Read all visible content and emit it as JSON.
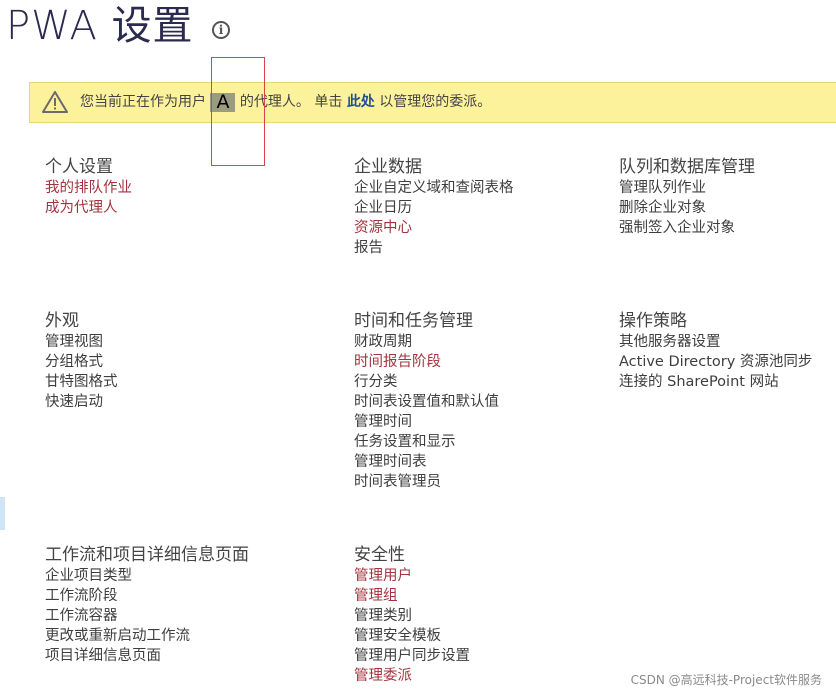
{
  "page": {
    "title": "PWA 设置",
    "info_icon": "info-icon"
  },
  "banner": {
    "icon": "warning-icon",
    "before": "您当前正在作为用户",
    "user": "A",
    "after_user": "的代理人。 单击",
    "link": "此处",
    "after_link": "以管理您的委派。"
  },
  "colors": {
    "link_red": "#a3343f",
    "link_dark": "#3e3e3e",
    "banner_bg": "#fcf29c",
    "banner_link": "#1f4e99"
  },
  "sections": {
    "personal": {
      "title": "个人设置",
      "links": [
        "我的排队作业",
        "成为代理人"
      ]
    },
    "enterprise": {
      "title": "企业数据",
      "links": [
        "企业自定义域和查阅表格",
        "企业日历",
        "资源中心",
        "报告"
      ]
    },
    "queue": {
      "title": "队列和数据库管理",
      "links": [
        "管理队列作业",
        "删除企业对象",
        "强制签入企业对象"
      ]
    },
    "appearance": {
      "title": "外观",
      "links": [
        "管理视图",
        "分组格式",
        "甘特图格式",
        "快速启动"
      ]
    },
    "time": {
      "title": "时间和任务管理",
      "links": [
        "财政周期",
        "时间报告阶段",
        "行分类",
        "时间表设置值和默认值",
        "管理时间",
        "任务设置和显示",
        "管理时间表",
        "时间表管理员"
      ]
    },
    "ops": {
      "title": "操作策略",
      "links": [
        "其他服务器设置",
        "Active Directory 资源池同步",
        "连接的 SharePoint 网站"
      ]
    },
    "workflow": {
      "title": "工作流和项目详细信息页面",
      "links": [
        "企业项目类型",
        "工作流阶段",
        "工作流容器",
        "更改或重新启动工作流",
        "项目详细信息页面"
      ]
    },
    "security": {
      "title": "安全性",
      "links": [
        "管理用户",
        "管理组",
        "管理类别",
        "管理安全模板",
        "管理用户同步设置",
        "管理委派"
      ]
    }
  },
  "watermark": "CSDN @高远科技-Project软件服务"
}
